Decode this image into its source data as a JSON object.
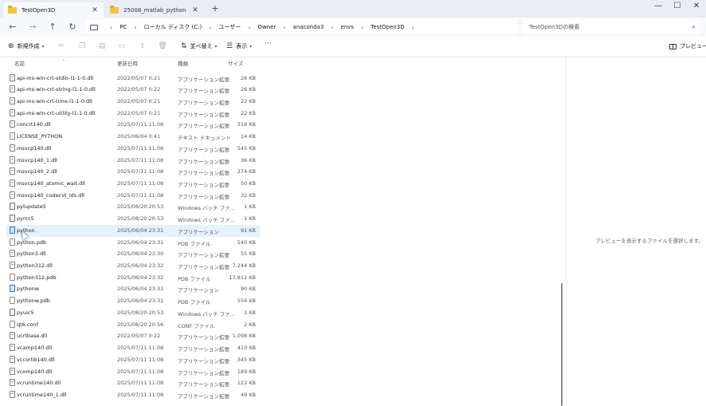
{
  "tabs": [
    {
      "label": "TestOpen3D",
      "active": true
    },
    {
      "label": "25008_matlab_python",
      "active": false
    }
  ],
  "window_controls": {
    "minimize": "—",
    "maximize": "☐",
    "close": "✕"
  },
  "breadcrumb": [
    "PC",
    "ローカル ディスク (C:)",
    "ユーザー",
    "Owner",
    "anaconda3",
    "envs",
    "TestOpen3D"
  ],
  "search": {
    "placeholder": "TestOpen3Dの検索"
  },
  "toolbar": {
    "new_label": "新規作成",
    "sort_label": "並べ替え",
    "view_label": "表示",
    "more_label": "···",
    "preview_label": "プレビュー"
  },
  "columns": {
    "name": "名前",
    "date": "更新日時",
    "type": "種類",
    "size": "サイズ"
  },
  "files": [
    {
      "name": "api-ms-win-crt-stdio-l1-1-0.dll",
      "date": "2022/05/07 0:21",
      "type": "アプリケーション拡張",
      "size": "26 KB",
      "icon": "dll"
    },
    {
      "name": "api-ms-win-crt-string-l1-1-0.dll",
      "date": "2022/05/07 0:22",
      "type": "アプリケーション拡張",
      "size": "26 KB",
      "icon": "dll"
    },
    {
      "name": "api-ms-win-crt-time-l1-1-0.dll",
      "date": "2022/05/07 0:21",
      "type": "アプリケーション拡張",
      "size": "22 KB",
      "icon": "dll"
    },
    {
      "name": "api-ms-win-crt-utility-l1-1-0.dll",
      "date": "2022/05/07 0:21",
      "type": "アプリケーション拡張",
      "size": "22 KB",
      "icon": "dll"
    },
    {
      "name": "concrt140.dll",
      "date": "2025/07/11 11:08",
      "type": "アプリケーション拡張",
      "size": "318 KB",
      "icon": "dll"
    },
    {
      "name": "LICENSE_PYTHON",
      "date": "2025/06/04 0:41",
      "type": "テキスト ドキュメント",
      "size": "14 KB",
      "icon": "txt"
    },
    {
      "name": "msvcp140.dll",
      "date": "2025/07/11 11:08",
      "type": "アプリケーション拡張",
      "size": "545 KB",
      "icon": "dll"
    },
    {
      "name": "msvcp140_1.dll",
      "date": "2025/07/11 11:08",
      "type": "アプリケーション拡張",
      "size": "36 KB",
      "icon": "dll"
    },
    {
      "name": "msvcp140_2.dll",
      "date": "2025/07/11 11:08",
      "type": "アプリケーション拡張",
      "size": "274 KB",
      "icon": "dll"
    },
    {
      "name": "msvcp140_atomic_wait.dll",
      "date": "2025/07/11 11:08",
      "type": "アプリケーション拡張",
      "size": "50 KB",
      "icon": "dll"
    },
    {
      "name": "msvcp140_codecvt_ids.dll",
      "date": "2025/07/11 11:08",
      "type": "アプリケーション拡張",
      "size": "32 KB",
      "icon": "dll"
    },
    {
      "name": "pylupdate5",
      "date": "2025/08/20 20:53",
      "type": "Windows バッチ ファ...",
      "size": "1 KB",
      "icon": "batch"
    },
    {
      "name": "pyrcc5",
      "date": "2025/08/20 20:53",
      "type": "Windows バッチ ファ...",
      "size": "1 KB",
      "icon": "batch"
    },
    {
      "name": "python",
      "date": "2025/06/04 23:31",
      "type": "アプリケーション",
      "size": "91 KB",
      "icon": "exe",
      "selected": true
    },
    {
      "name": "python.pdb",
      "date": "2025/06/04 23:31",
      "type": "PDB ファイル",
      "size": "540 KB",
      "icon": "txt"
    },
    {
      "name": "python3.dll",
      "date": "2025/06/04 23:30",
      "type": "アプリケーション拡張",
      "size": "55 KB",
      "icon": "dll"
    },
    {
      "name": "python312.dll",
      "date": "2025/06/04 23:32",
      "type": "アプリケーション拡張",
      "size": "7,244 KB",
      "icon": "dll"
    },
    {
      "name": "python312.pdb",
      "date": "2025/06/04 23:32",
      "type": "PDB ファイル",
      "size": "17,812 KB",
      "icon": "txt"
    },
    {
      "name": "pythonw",
      "date": "2025/06/04 23:31",
      "type": "アプリケーション",
      "size": "90 KB",
      "icon": "exe"
    },
    {
      "name": "pythonw.pdb",
      "date": "2025/06/04 23:31",
      "type": "PDB ファイル",
      "size": "556 KB",
      "icon": "txt"
    },
    {
      "name": "pyuic5",
      "date": "2025/08/20 20:53",
      "type": "Windows バッチ ファ...",
      "size": "1 KB",
      "icon": "batch"
    },
    {
      "name": "qt6.conf",
      "date": "2025/08/20 20:56",
      "type": "CONF ファイル",
      "size": "2 KB",
      "icon": "txt"
    },
    {
      "name": "ucrtbase.dll",
      "date": "2022/05/07 0:22",
      "type": "アプリケーション拡張",
      "size": "1,098 KB",
      "icon": "dll"
    },
    {
      "name": "vcamp140.dll",
      "date": "2025/07/11 11:08",
      "type": "アプリケーション拡張",
      "size": "410 KB",
      "icon": "dll"
    },
    {
      "name": "vccorlib140.dll",
      "date": "2025/07/11 11:08",
      "type": "アプリケーション拡張",
      "size": "345 KB",
      "icon": "dll"
    },
    {
      "name": "vcomp140.dll",
      "date": "2025/07/11 11:08",
      "type": "アプリケーション拡張",
      "size": "189 KB",
      "icon": "dll"
    },
    {
      "name": "vcruntime140.dll",
      "date": "2025/07/11 11:08",
      "type": "アプリケーション拡張",
      "size": "122 KB",
      "icon": "dll"
    },
    {
      "name": "vcruntime140_1.dll",
      "date": "2025/07/11 11:08",
      "type": "アプリケーション拡張",
      "size": "49 KB",
      "icon": "dll"
    }
  ],
  "preview": {
    "message": "プレビューを表示するファイルを選択します。"
  },
  "colors": {
    "selected_row": "#e5f1fb",
    "folder": "#f3c14b",
    "chrome": "#e9eef5"
  }
}
